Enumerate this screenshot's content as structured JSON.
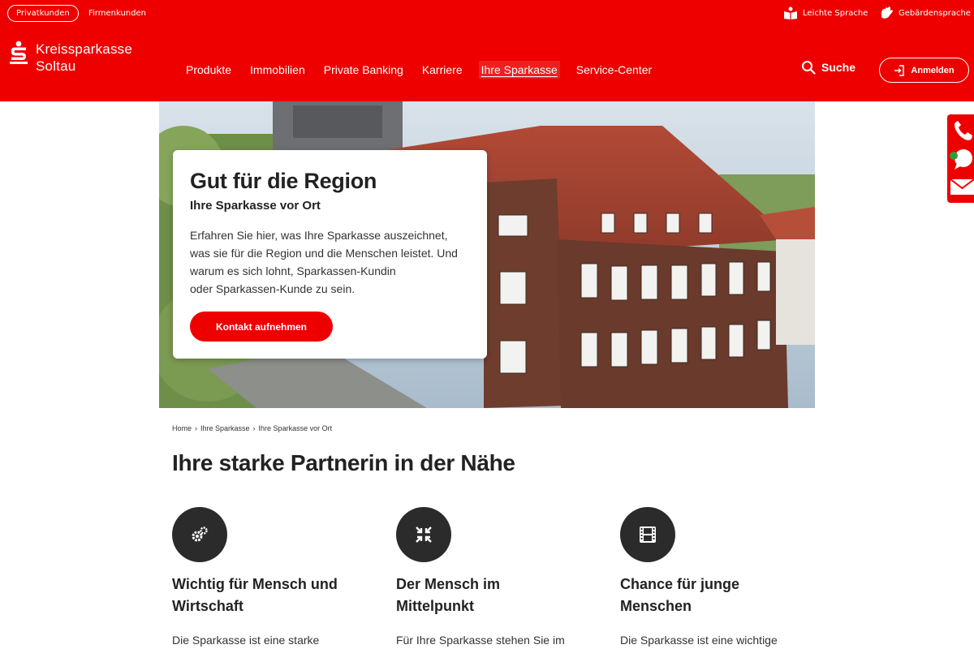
{
  "topbar": {
    "segments": [
      "Privatkunden",
      "Firmenkunden"
    ],
    "easy_language": "Leichte Sprache",
    "sign_language": "Gebärdensprache"
  },
  "header": {
    "logo_line1": "Kreissparkasse",
    "logo_line2": "Soltau",
    "nav": [
      "Produkte",
      "Immobilien",
      "Private Banking",
      "Karriere",
      "Ihre Sparkasse",
      "Service-Center"
    ],
    "active_nav": "Ihre Sparkasse",
    "search_label": "Suche",
    "login_label": "Anmelden"
  },
  "hero": {
    "title": "Gut für die Region",
    "subtitle": "Ihre Sparkasse vor Ort",
    "text_lines": [
      "Erfahren Sie hier, was Ihre Sparkasse auszeichnet,",
      "was sie für die Region und die Menschen leistet. Und",
      "warum es sich lohnt, Sparkassen-Kundin",
      "oder Sparkassen-Kunde zu sein."
    ],
    "button_label": "Kontakt aufnehmen"
  },
  "contact_tab": {
    "icons": [
      "phone-icon",
      "chat-icon",
      "mail-icon"
    ]
  },
  "breadcrumb": [
    "Home",
    "Ihre Sparkasse",
    "Ihre Sparkasse vor Ort"
  ],
  "main": {
    "title": "Ihre starke Partnerin in der Nähe",
    "features": [
      {
        "icon": "gears-icon",
        "title_lines": [
          "Wichtig für Mensch und",
          "Wirtschaft"
        ],
        "text": "Die Sparkasse ist eine starke"
      },
      {
        "icon": "compress-arrows-icon",
        "title_lines": [
          "Der Mensch im",
          "Mittelpunkt"
        ],
        "text": "Für Ihre Sparkasse stehen Sie im"
      },
      {
        "icon": "film-icon",
        "title_lines": [
          "Chance für junge",
          "Menschen"
        ],
        "text": "Die Sparkasse ist eine wichtige"
      }
    ]
  },
  "colors": {
    "brand_red": "#ee0000",
    "icon_circle": "#2b2b2b",
    "text_dark": "#222222"
  }
}
